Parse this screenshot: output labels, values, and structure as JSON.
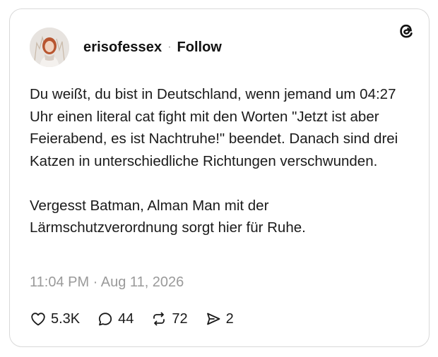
{
  "post": {
    "username": "erisofessex",
    "separator": "·",
    "follow_label": "Follow",
    "paragraphs": [
      "Du weißt, du bist in Deutschland, wenn jemand um 04:27 Uhr einen literal cat fight mit den Worten \"Jetzt ist aber Feierabend, es ist Nachtruhe!\" beendet. Danach sind drei Katzen in unterschiedliche Richtungen verschwunden.",
      "Vergesst Batman, Alman Man mit der Lärmschutzverordnung sorgt hier für Ruhe."
    ],
    "timestamp": "11:04 PM · Aug 11, 2026"
  },
  "actions": {
    "likes": "5.3K",
    "replies": "44",
    "reposts": "72",
    "shares": "2"
  },
  "icons": {
    "brand": "threads-logo-icon",
    "like": "heart-icon",
    "reply": "speech-bubble-icon",
    "repost": "repost-arrows-icon",
    "share": "send-icon"
  },
  "colors": {
    "text": "#1a1a1a",
    "muted": "#9a9a9a",
    "border": "#d9d9d9"
  }
}
